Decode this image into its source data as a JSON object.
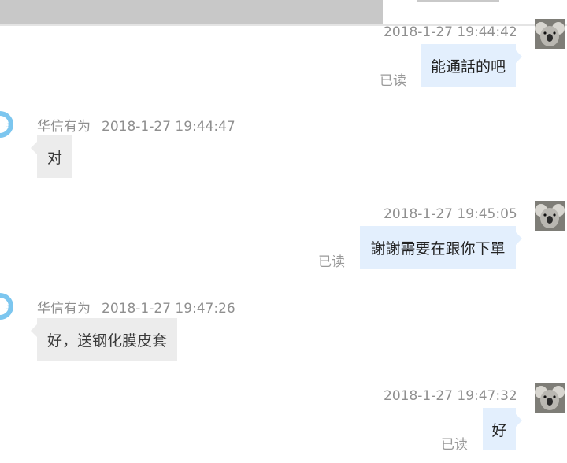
{
  "messages": [
    {
      "side": "right",
      "timestamp": "2018-1-27 19:44:42",
      "text": "能通話的吧",
      "status": "已读"
    },
    {
      "side": "left",
      "sender": "华信有为",
      "timestamp": "2018-1-27 19:44:47",
      "text": "对"
    },
    {
      "side": "right",
      "timestamp": "2018-1-27 19:45:05",
      "text": "謝謝需要在跟你下單",
      "status": "已读"
    },
    {
      "side": "left",
      "sender": "华信有为",
      "timestamp": "2018-1-27 19:47:26",
      "text": "好，送钢化膜皮套"
    },
    {
      "side": "right",
      "timestamp": "2018-1-27 19:47:32",
      "text": "好",
      "status": "已读"
    }
  ],
  "icons": {
    "user_avatar": "koala-avatar-icon",
    "contact_avatar": "contact-avatar-icon"
  },
  "colors": {
    "sent_bubble": "#e3effd",
    "received_bubble": "#ececec",
    "meta_text": "#8f8f8f",
    "contact_avatar_ring": "#7cc6ef"
  }
}
